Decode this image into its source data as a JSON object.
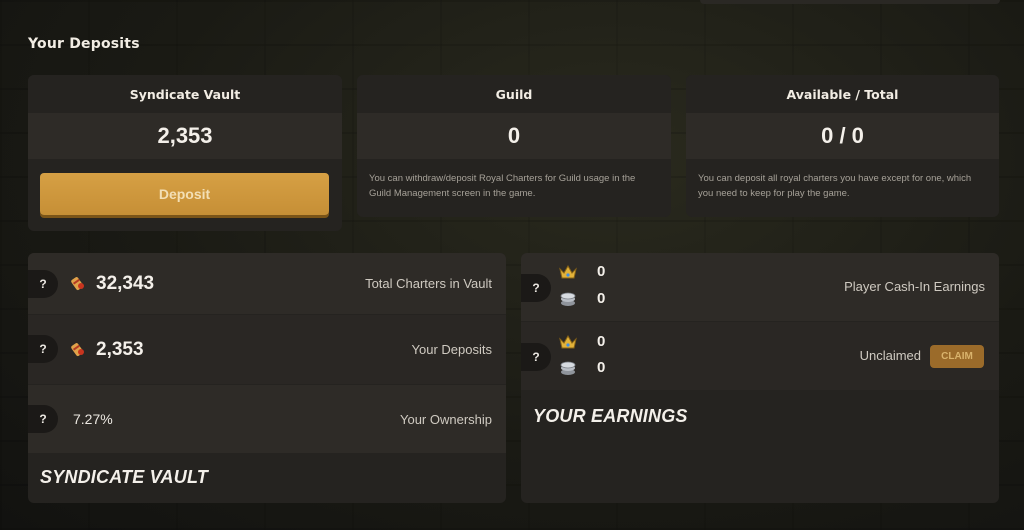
{
  "section_title": "Your Deposits",
  "cards": {
    "vault": {
      "title": "Syndicate Vault",
      "value": "2,353",
      "button_label": "Deposit"
    },
    "guild": {
      "title": "Guild",
      "value": "0",
      "note": "You can withdraw/deposit Royal Charters for Guild usage in the Guild Management screen in the game."
    },
    "available": {
      "title": "Available / Total",
      "value": "0 / 0",
      "note": "You can deposit all royal charters you have except for one, which you need to keep for play the game."
    }
  },
  "vault_panel": {
    "title": "SYNDICATE VAULT",
    "help_label": "?",
    "rows": [
      {
        "value": "32,343",
        "label": "Total Charters in Vault",
        "icon": "charter-icon"
      },
      {
        "value": "2,353",
        "label": "Your Deposits",
        "icon": "charter-icon"
      },
      {
        "value": "7.27%",
        "label": "Your Ownership"
      }
    ]
  },
  "earnings_panel": {
    "title": "YOUR EARNINGS",
    "help_label": "?",
    "rows": [
      {
        "label": "Player Cash-In Earnings",
        "crown_value": "0",
        "coin_value": "0"
      },
      {
        "label": "Unclaimed",
        "crown_value": "0",
        "coin_value": "0",
        "claim_label": "CLAIM"
      }
    ]
  },
  "colors": {
    "accent": "#d29a3e",
    "card_bg": "#252320",
    "row_bg": "#2e2b27"
  }
}
